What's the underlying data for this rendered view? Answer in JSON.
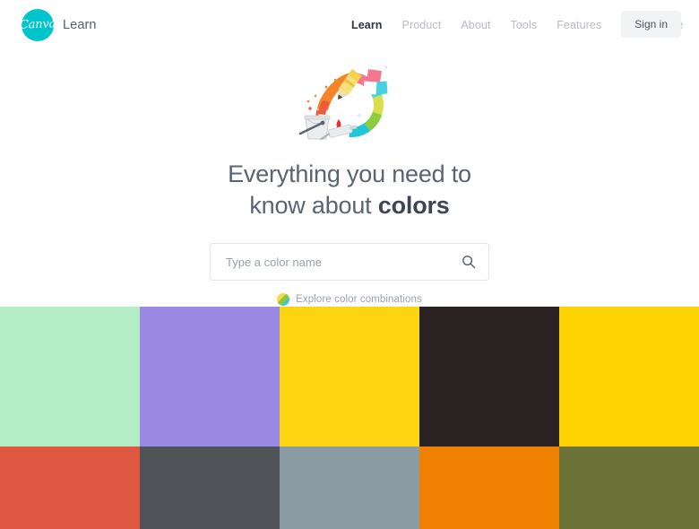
{
  "header": {
    "logo_text": "Canva",
    "logo_icon": "canva-logo-icon",
    "brand_label": "Learn",
    "brand_color": "#00c4cc",
    "nav_items": [
      {
        "label": "Learn",
        "active": true
      },
      {
        "label": "Product",
        "active": false
      },
      {
        "label": "About",
        "active": false
      },
      {
        "label": "Tools",
        "active": false
      },
      {
        "label": "Features",
        "active": false
      },
      {
        "label": "Marketplace",
        "active": false
      }
    ],
    "signin_label": "Sign in"
  },
  "hero": {
    "illustration_name": "color-wheel-paint-illustration",
    "headline_line1": "Everything you need to",
    "headline_line2_prefix": "know about ",
    "headline_line2_emphasis": "colors"
  },
  "search": {
    "placeholder": "Type a color name",
    "value": "",
    "icon": "search-icon"
  },
  "explore": {
    "label": "Explore color combinations",
    "icon": "color-circle-icon"
  },
  "swatches": {
    "columns": 5,
    "rows": 2,
    "top_row": [
      {
        "hex": "#b2edc5",
        "name": "mint-green"
      },
      {
        "hex": "#9b8ae3",
        "name": "medium-purple"
      },
      {
        "hex": "#fcd411",
        "name": "golden-yellow"
      },
      {
        "hex": "#2b2224",
        "name": "dark-brown-black"
      },
      {
        "hex": "#fdd200",
        "name": "vivid-yellow"
      }
    ],
    "bottom_row": [
      {
        "hex": "#e05842",
        "name": "coral-red"
      },
      {
        "hex": "#4f5256",
        "name": "slate-gray"
      },
      {
        "hex": "#8a9ba3",
        "name": "blue-gray"
      },
      {
        "hex": "#f08000",
        "name": "orange"
      },
      {
        "hex": "#6b7338",
        "name": "olive-green"
      }
    ]
  }
}
